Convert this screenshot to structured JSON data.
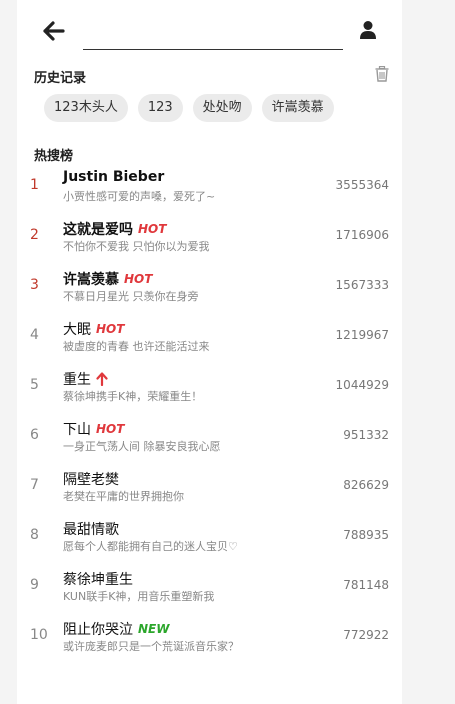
{
  "header": {
    "back_icon": "arrow-left-icon",
    "search_value": "",
    "user_icon": "user-icon"
  },
  "history": {
    "title": "历史记录",
    "clear_icon": "trash-icon",
    "items": [
      "123木头人",
      "123",
      "处处吻",
      "许嵩羡慕"
    ]
  },
  "hot": {
    "title": "热搜榜",
    "items": [
      {
        "rank": "1",
        "title": "Justin Bieber",
        "tag": "",
        "sub": "小贾性感可爱的声嗓，爱死了~",
        "count": "3555364"
      },
      {
        "rank": "2",
        "title": "这就是爱吗",
        "tag": "HOT",
        "sub": "不怕你不爱我 只怕你以为爱我",
        "count": "1716906"
      },
      {
        "rank": "3",
        "title": "许嵩羡慕",
        "tag": "HOT",
        "sub": "不慕日月星光 只羡你在身旁",
        "count": "1567333"
      },
      {
        "rank": "4",
        "title": "大眠",
        "tag": "HOT",
        "sub": "被虚度的青春 也许还能活过来",
        "count": "1219967"
      },
      {
        "rank": "5",
        "title": "重生",
        "tag": "UP",
        "sub": "蔡徐坤携手K神，荣耀重生！",
        "count": "1044929"
      },
      {
        "rank": "6",
        "title": "下山",
        "tag": "HOT",
        "sub": "一身正气荡人间 除暴安良我心愿",
        "count": "951332"
      },
      {
        "rank": "7",
        "title": "隔壁老樊",
        "tag": "",
        "sub": "老樊在平庸的世界拥抱你",
        "count": "826629"
      },
      {
        "rank": "8",
        "title": "最甜情歌",
        "tag": "",
        "sub": "愿每个人都能拥有自己的迷人宝贝♡",
        "count": "788935"
      },
      {
        "rank": "9",
        "title": "蔡徐坤重生",
        "tag": "",
        "sub": "KUN联手K神，用音乐重塑新我",
        "count": "781148"
      },
      {
        "rank": "10",
        "title": "阻止你哭泣",
        "tag": "NEW",
        "sub": "或许庞麦郎只是一个荒诞派音乐家？",
        "count": "772922"
      }
    ]
  },
  "colors": {
    "hot": "#e0383c",
    "new": "#2ba62b",
    "top_rank": "#c0392b",
    "up_arrow": "#e0383c"
  }
}
